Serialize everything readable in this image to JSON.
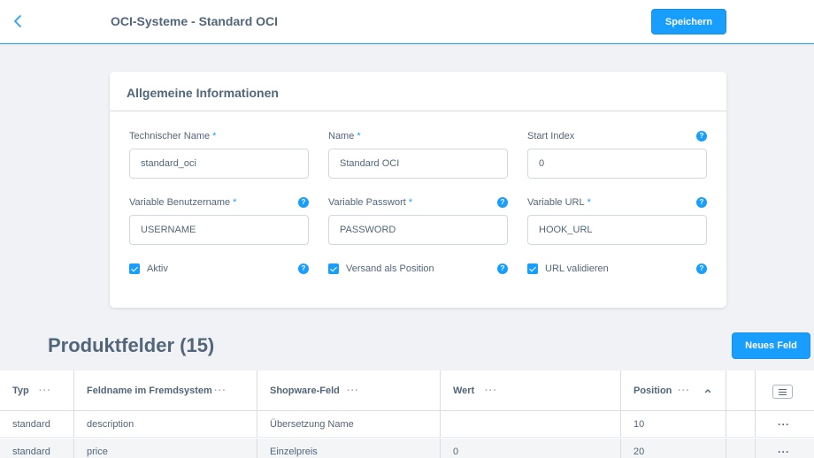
{
  "header": {
    "title": "OCI-Systeme - Standard OCI",
    "save_label": "Speichern"
  },
  "card": {
    "title": "Allgemeine Informationen",
    "fields": {
      "technical_name": {
        "label": "Technischer Name",
        "value": "standard_oci",
        "required": "*"
      },
      "name": {
        "label": "Name",
        "value": "Standard OCI",
        "required": "*"
      },
      "start_index": {
        "label": "Start Index",
        "value": "0"
      },
      "var_username": {
        "label": "Variable Benutzername",
        "value": "USERNAME",
        "required": "*"
      },
      "var_password": {
        "label": "Variable Passwort",
        "value": "PASSWORD",
        "required": "*"
      },
      "var_url": {
        "label": "Variable URL",
        "value": "HOOK_URL",
        "required": "*"
      }
    },
    "checkboxes": {
      "active": "Aktiv",
      "shipping_as_position": "Versand als Position",
      "validate_url": "URL validieren"
    },
    "help_glyph": "?"
  },
  "products": {
    "title": "Produktfelder (15)",
    "new_field_label": "Neues Feld",
    "columns": [
      "Typ",
      "Feldname im Fremdsystem",
      "Shopware-Feld",
      "Wert",
      "Position"
    ],
    "rows": [
      {
        "type": "standard",
        "field_name": "description",
        "shopware_field": "Übersetzung Name",
        "value": "",
        "position": "10"
      },
      {
        "type": "standard",
        "field_name": "price",
        "shopware_field": "Einzelpreis",
        "value": "0",
        "position": "20"
      }
    ],
    "col_dots": "···",
    "row_dots": "···"
  },
  "colors": {
    "accent": "#189eff",
    "text": "#52667a",
    "background": "#f0f2f5"
  },
  "icons": {
    "back": "chevron-left-icon",
    "help": "help-circle-icon",
    "sort": "chevron-up-icon",
    "menu": "list-icon"
  }
}
